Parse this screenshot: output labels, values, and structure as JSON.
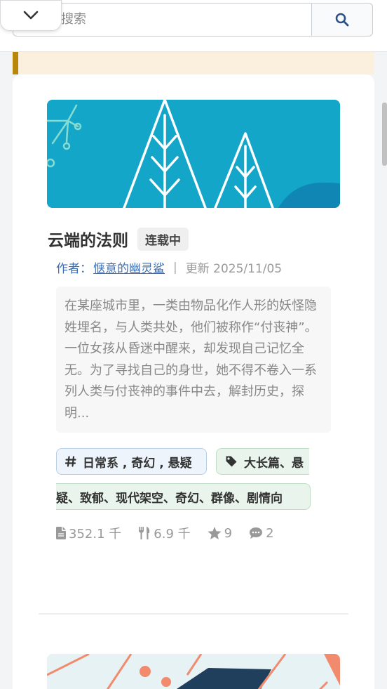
{
  "search": {
    "placeholder": "词搜索"
  },
  "book": {
    "title": "云端的法则",
    "status": "连载中",
    "author_label": "作者：",
    "author_name": "惬意的幽灵鲨",
    "separator": "|",
    "updated": "更新 2025/11/05",
    "summary": "在某座城市里，一类由物品化作人形的妖怪隐姓埋名，与人类共处，他们被称作“付丧神”。一位女孩从昏迷中醒来，却发现自己记忆全无。为了寻找自己的身世，她不得不卷入一系列人类与付丧神的事件中去，解封历史，探明...",
    "genre_tag": "日常系 , 奇幻 , 悬疑",
    "keyword_tag_line1": "大长篇、悬",
    "keyword_tag_line2": "疑、致郁、现代架空、奇幻、群像、剧情向",
    "stats": {
      "words": "352.1 千",
      "food": "6.9 千",
      "stars": "9",
      "comments": "2"
    }
  },
  "icons": [
    "chevron-down-icon",
    "search-icon",
    "hashtag-icon",
    "tag-icon",
    "file-icon",
    "utensils-icon",
    "star-icon",
    "comment-icon"
  ],
  "colors": {
    "accent": "#3a6fb5",
    "cover": "#13a6c9",
    "notice_border": "#b8860b"
  }
}
